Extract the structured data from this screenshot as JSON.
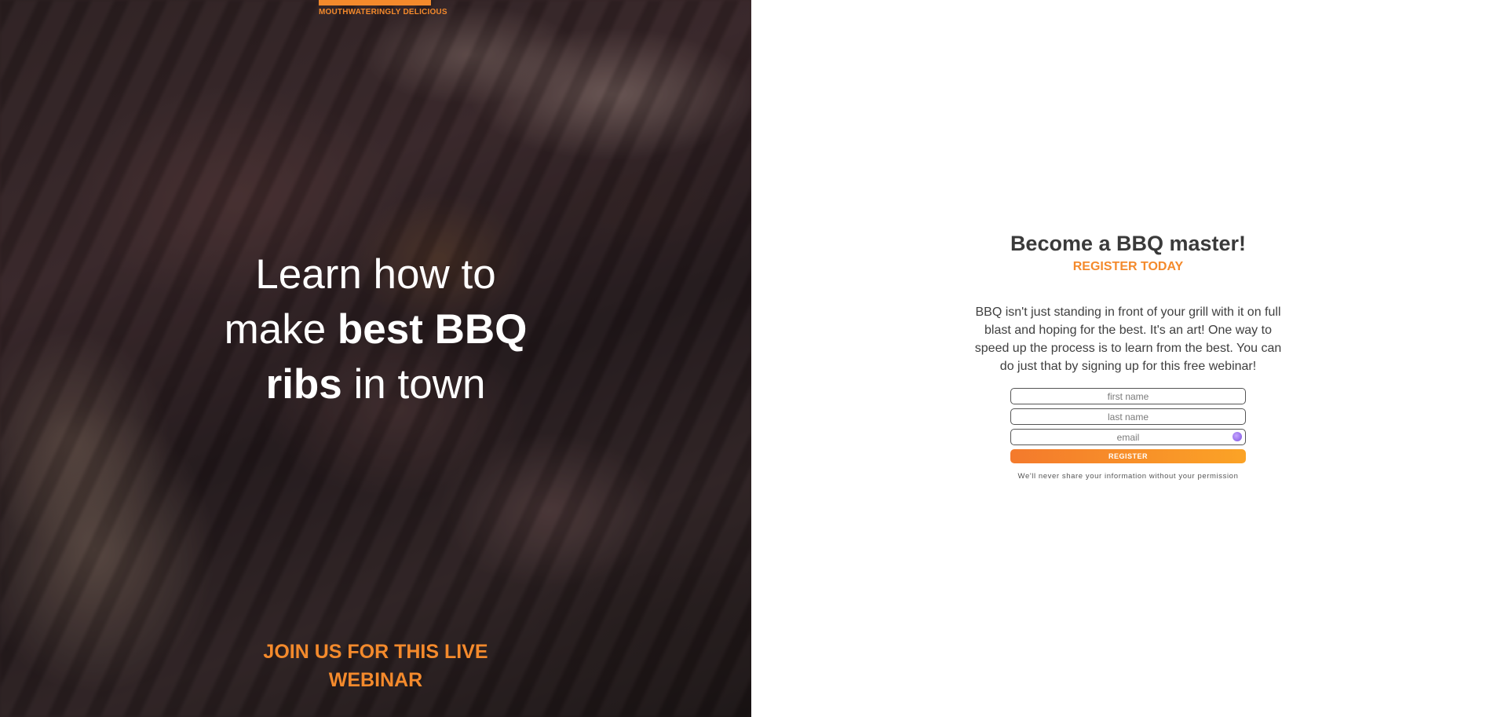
{
  "hero": {
    "tagline": "MOUTHWATERINGLY DELICIOUS",
    "headline_line1": "Learn how to",
    "headline_line2_light": "make ",
    "headline_line2_bold": "best BBQ",
    "headline_line3_bold": "ribs",
    "headline_line3_light": " in town",
    "join_line1": "JOIN US FOR THIS LIVE",
    "join_line2": "WEBINAR"
  },
  "form": {
    "title": "Become a BBQ master!",
    "subtitle": "REGISTER TODAY",
    "description": "BBQ isn't just standing in front of your grill with it on full blast and hoping for the best. It's an art! One way to speed up the process is to learn from the best. You can do just that by signing up for this free webinar!",
    "first_name_placeholder": "first name",
    "last_name_placeholder": "last name",
    "email_placeholder": "email",
    "register_label": "REGISTER",
    "privacy_note": "We'll never share your information without your permission"
  },
  "colors": {
    "accent": "#f48a2c",
    "heading": "#3a3a3a"
  }
}
